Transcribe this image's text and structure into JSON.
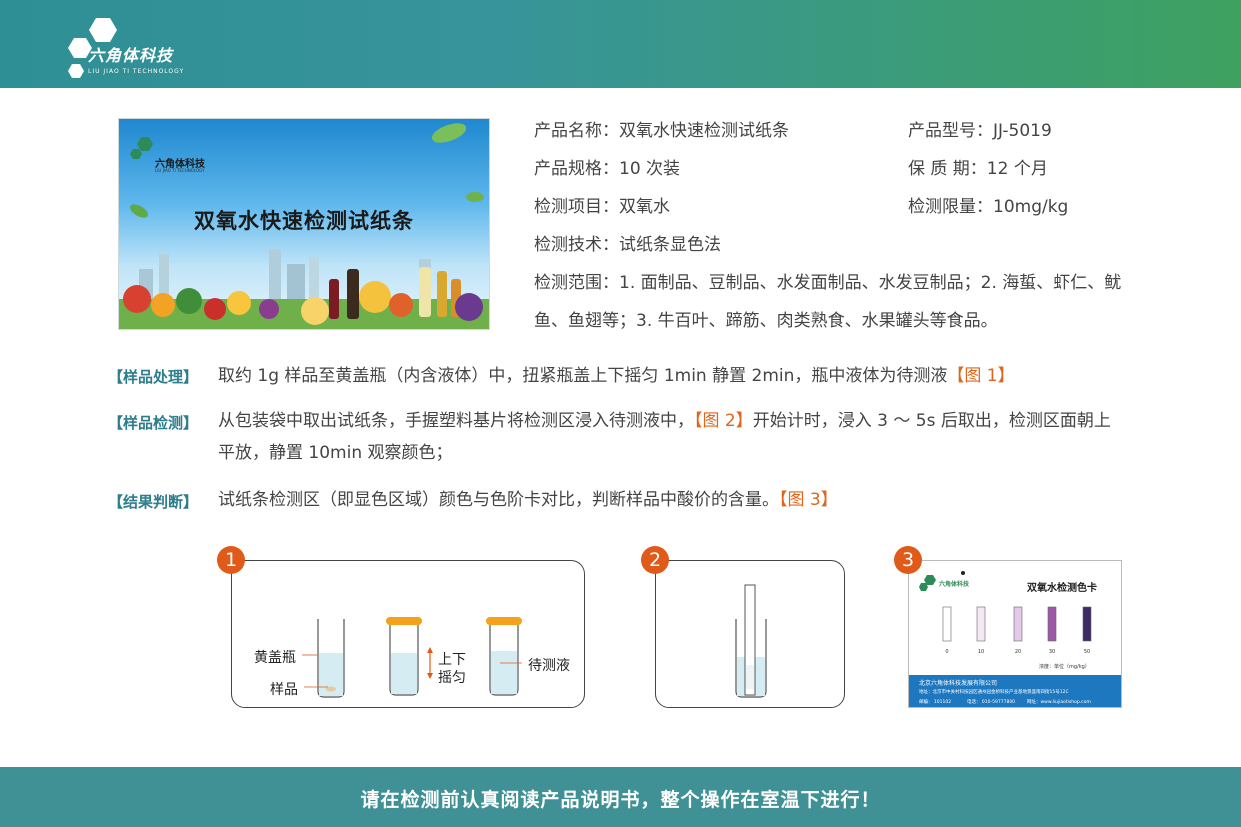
{
  "header": {
    "logo_cn": "六角体科技",
    "logo_en": "LIU JIAO TI TECHNOLOGY"
  },
  "banner": {
    "brand_cn": "六角体科技",
    "brand_en": "LIU JIAO TI TECHNOLOGY",
    "title": "双氧水快速检测试纸条"
  },
  "product": {
    "name": "产品名称：双氧水快速检测试纸条",
    "model": "产品型号：JJ-5019",
    "spec": "产品规格：10 次装",
    "shelf_life": "保 质 期：12 个月",
    "item": "检测项目：双氧水",
    "limit": "检测限量：10mg/kg",
    "tech": "检测技术：试纸条显色法",
    "scope": "检测范围：1. 面制品、豆制品、水发面制品、水发豆制品；2. 海蜇、虾仁、鱿鱼、鱼翅等；3. 牛百叶、蹄筋、肉类熟食、水果罐头等食品。"
  },
  "steps": [
    {
      "label": "【样品处理】",
      "text": "取约 1g 样品至黄盖瓶（内含液体）中，扭紧瓶盖上下摇匀 1min 静置 2min，瓶中液体为待测液",
      "ref": "【图 1】"
    },
    {
      "label": "【样品检测】",
      "text_a": "从包装袋中取出试纸条，手握塑料基片将检测区浸入待测液中，",
      "ref": "【图 2】",
      "text_b": "开始计时，浸入 3 ～ 5s 后取出，检测区面朝上平放，静置 10min 观察颜色；"
    },
    {
      "label": "【结果判断】",
      "text": "试纸条检测区（即显色区域）颜色与色阶卡对比，判断样品中酸价的含量。",
      "ref": "【图 3】"
    }
  ],
  "figures": {
    "n1": "1",
    "n2": "2",
    "n3": "3",
    "bottle_label": "黄盖瓶",
    "sample_label": "样品",
    "shake_label_1": "上下",
    "shake_label_2": "摇匀",
    "liquid_label": "待测液"
  },
  "color_card": {
    "brand": "六角体科技",
    "title": "双氧水检测色卡",
    "ticks": [
      "0",
      "10",
      "20",
      "30",
      "50"
    ],
    "colors": [
      "#ffffff",
      "#f3e9f6",
      "#e4c9ea",
      "#9a5aa8",
      "#3d2b66"
    ],
    "unit": "浓度：单位（mg/kg）",
    "company": "北京六角体科技发展有限公司",
    "address": "地址：北京市中关村科技园区通州园金桥科技产业基地景盛南四街15号12C",
    "postcode": "邮编：  101102",
    "tel": "电话：  010-59777800",
    "web": "网址：www.liujiaotishop.com"
  },
  "footer": {
    "notice": "请在检测前认真阅读产品说明书，整个操作在室温下进行！"
  }
}
